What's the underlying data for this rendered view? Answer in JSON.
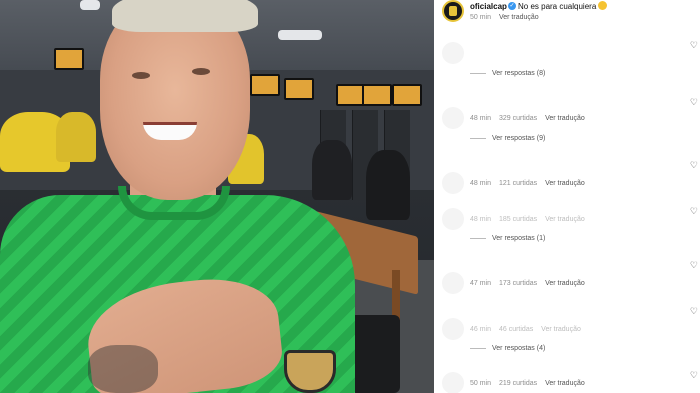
{
  "post": {
    "username": "oficialcap",
    "caption": "No es para cualquiera",
    "time": "50 min",
    "translate_label": "Ver tradução"
  },
  "comments": [
    {
      "time": "",
      "likes": "",
      "translate": ""
    },
    {
      "time": "48 min",
      "likes": "329 curtidas",
      "translate": "Ver tradução"
    },
    {
      "time": "48 min",
      "likes": "121 curtidas",
      "translate": "Ver tradução"
    },
    {
      "time": "48 min",
      "likes": "185 curtidas",
      "translate": "Ver tradução"
    },
    {
      "time": "47 min",
      "likes": "173 curtidas",
      "translate": "Ver tradução"
    },
    {
      "time": "46 min",
      "likes": "46 curtidas",
      "translate": "Ver tradução"
    },
    {
      "time": "50 min",
      "likes": "219 curtidas",
      "translate": "Ver tradução"
    }
  ],
  "replies": [
    {
      "label": "Ver respostas (8)"
    },
    {
      "label": "Ver respostas (9)"
    },
    {
      "label": "Ver respostas (1)"
    },
    {
      "label": "Ver respostas (4)"
    }
  ],
  "icons": {
    "like": "heart-icon",
    "verified": "verified-badge-icon",
    "emoji": "smiling-face-icon"
  },
  "colors": {
    "verified": "#3897f0",
    "meta_text": "#8e8e8e",
    "jersey": "#2fbf58"
  }
}
